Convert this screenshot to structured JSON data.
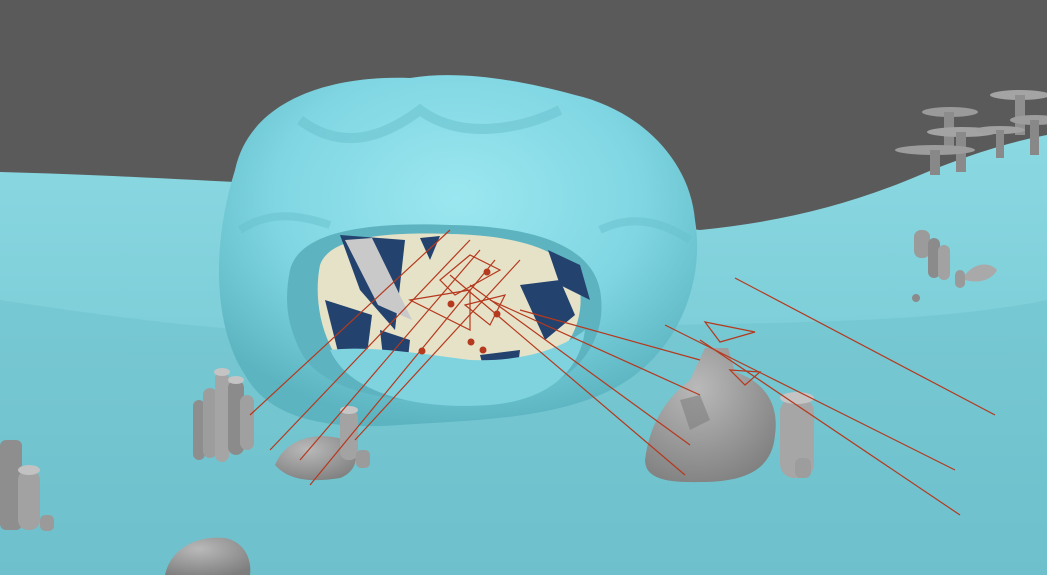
{
  "viewport": {
    "background_color": "#5a5a5a",
    "floor_color": "#7dcfd8",
    "floor_shadow_color": "#63b9c4",
    "mound_color": "#86dbe6",
    "mound_shadow_color": "#5fb6c2",
    "inner_paper_color": "#e6e2c8",
    "inner_dark_color": "#23426e",
    "rock_color": "#9b9b9b",
    "rock_shadow_color": "#6f6f6f",
    "ray_color": "#b5391e"
  },
  "scene_objects": {
    "mound": "hollow-mound",
    "cavity": "mound-cavity",
    "pillars_left": "pillar-cluster",
    "rock_right": "large-rock",
    "mushrooms": "mushroom-cluster",
    "rays": "guide-lines"
  }
}
